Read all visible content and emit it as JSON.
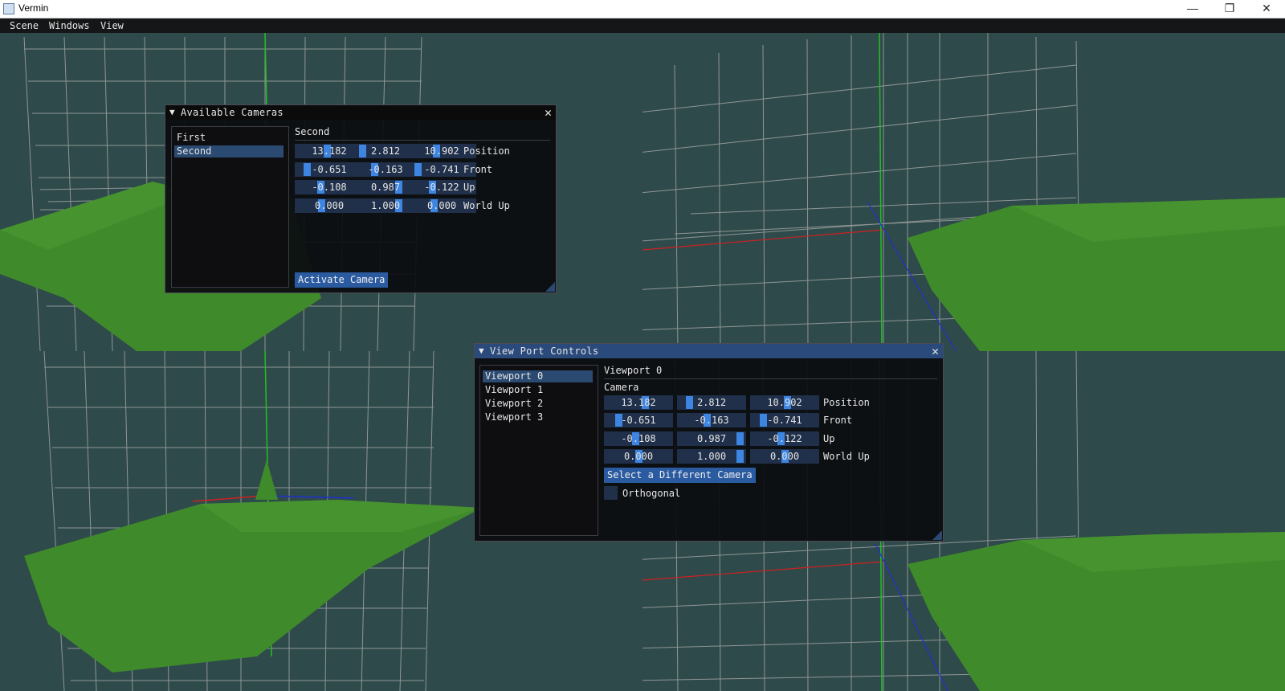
{
  "window": {
    "title": "Vermin",
    "minimize": "—",
    "restore": "❐",
    "close": "✕"
  },
  "menu": [
    "Scene",
    "Windows",
    "View"
  ],
  "cameras_panel": {
    "title": "Available Cameras",
    "cameras": [
      "First",
      "Second"
    ],
    "selected": "Second",
    "heading": "Second",
    "rows": [
      {
        "label": "Position",
        "values": [
          "13.182",
          "2.812",
          "10.902"
        ]
      },
      {
        "label": "Front",
        "values": [
          "-0.651",
          "-0.163",
          "-0.741"
        ]
      },
      {
        "label": "Up",
        "values": [
          "-0.108",
          "0.987",
          "-0.122"
        ]
      },
      {
        "label": "World Up",
        "values": [
          "0.000",
          "1.000",
          "0.000"
        ]
      }
    ],
    "activate_label": "Activate Camera"
  },
  "viewport_panel": {
    "title": "View Port Controls",
    "viewports": [
      "Viewport 0",
      "Viewport 1",
      "Viewport 2",
      "Viewport 3"
    ],
    "selected": "Viewport 0",
    "heading": "Viewport 0",
    "section": "Camera",
    "rows": [
      {
        "label": "Position",
        "values": [
          "13.182",
          "2.812",
          "10.902"
        ]
      },
      {
        "label": "Front",
        "values": [
          "-0.651",
          "-0.163",
          "-0.741"
        ]
      },
      {
        "label": "Up",
        "values": [
          "-0.108",
          "0.987",
          "-0.122"
        ]
      },
      {
        "label": "World Up",
        "values": [
          "0.000",
          "1.000",
          "0.000"
        ]
      }
    ],
    "select_camera_label": "Select a Different Camera",
    "orthogonal_label": "Orthogonal",
    "orthogonal_checked": false
  },
  "colors": {
    "background": "#2f4a4a",
    "accent": "#3d85e0",
    "terrain": "#3f8a2a",
    "grid": "#a8a8a8"
  }
}
